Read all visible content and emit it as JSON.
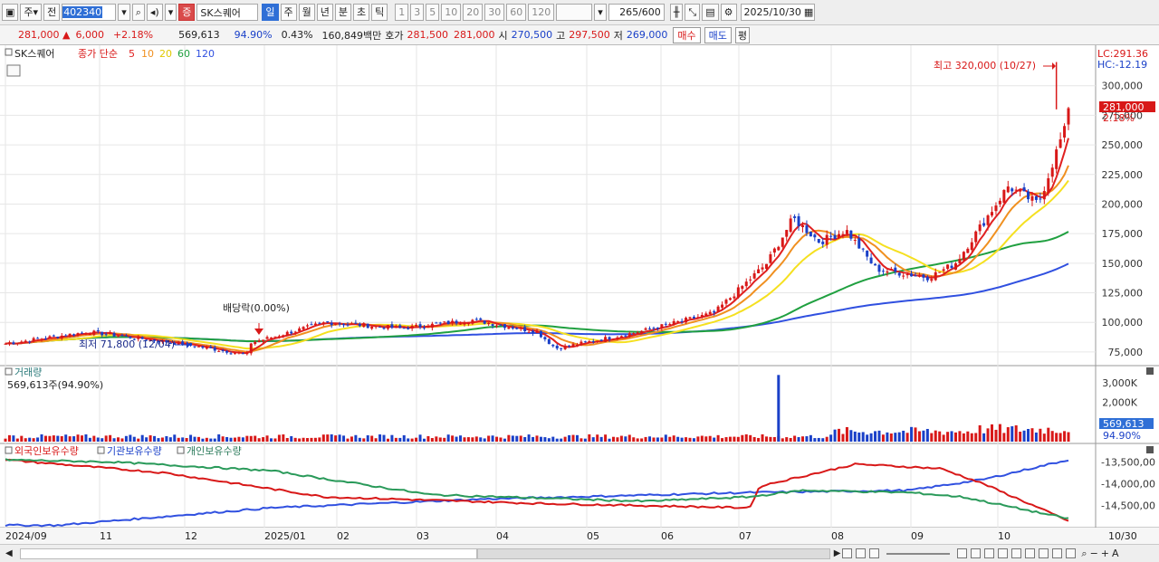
{
  "toolbar": {
    "type_label": "주",
    "prev_label": "전",
    "stock_code": "402340",
    "stock_name": "SK스퀘어",
    "badge_label": "증",
    "periods": [
      "일",
      "주",
      "월",
      "년",
      "분",
      "초",
      "틱"
    ],
    "selected_period": "일",
    "intervals": [
      "1",
      "3",
      "5",
      "10",
      "20",
      "30",
      "60",
      "120"
    ],
    "data_count": "265",
    "data_total": "/600",
    "date": "2025/10/30"
  },
  "quote": {
    "price": "281,000",
    "arrow": "▲",
    "change": "6,000",
    "change_pct": "+2.18%",
    "volume": "569,613",
    "vol_ratio": "94.90%",
    "turnover_pct": "0.43%",
    "amount": "160,849백만",
    "ask_label": "호가",
    "ask1": "281,500",
    "ask2": "281,000",
    "open_label": "시",
    "open": "270,500",
    "high_label": "고",
    "high": "297,500",
    "low_label": "저",
    "low": "269,000",
    "buy_label": "매수",
    "sell_label": "매도",
    "eval_label": "평"
  },
  "price_panel": {
    "stock_label": "SK스퀘어",
    "ma_label": "종가 단순",
    "ma_periods": [
      "5",
      "10",
      "20",
      "60",
      "120"
    ],
    "lc_label": "LC:291.36",
    "hc_label": "HC:-12.19",
    "high_annotation": "최고 320,000 (10/27)",
    "low_annotation": "최저 71,800 (12/04)",
    "dividend_annotation": "배당락(0.00%)",
    "current_price_tag": "281,000",
    "current_pct_tag": "2.18%",
    "y_ticks": [
      "300,000",
      "275,000",
      "250,000",
      "225,000",
      "200,000",
      "175,000",
      "150,000",
      "125,000",
      "100,000",
      "75,000"
    ]
  },
  "volume_panel": {
    "title": "거래량",
    "value_label": "569,613주(94.90%)",
    "y_ticks": [
      "3,000K",
      "2,000K",
      "1,000K"
    ],
    "current_tag": "569,613",
    "current_pct": "94.90%"
  },
  "holdings_panel": {
    "series_labels": [
      "외국인보유수량",
      "기관보유수량",
      "개인보유수량"
    ],
    "y_ticks": [
      "-13,500,00",
      "-14,000,00",
      "-14,500,00"
    ]
  },
  "x_axis": {
    "labels": [
      "2024/09",
      "11",
      "12",
      "2025/01",
      "02",
      "03",
      "04",
      "05",
      "06",
      "07",
      "08",
      "09",
      "10"
    ],
    "end_label": "10/30"
  },
  "colors": {
    "up": "#d81818",
    "down": "#1a40c8",
    "ma5": "#e02020",
    "ma10": "#f09020",
    "ma20": "#f5e020",
    "ma60": "#20a040",
    "ma120": "#3050e0",
    "foreign": "#3050e0",
    "institution": "#d81818",
    "individual": "#2a9a5a"
  },
  "chart_data": {
    "type": "candlestick",
    "ylim": [
      65000,
      325000
    ],
    "months": [
      "2024/09",
      "11",
      "12",
      "2025/01",
      "02",
      "03",
      "04",
      "05",
      "06",
      "07",
      "08",
      "09",
      "10"
    ],
    "close_key_points": [
      {
        "date": "2024-09",
        "value": 82000
      },
      {
        "date": "2024-10",
        "value": 92000
      },
      {
        "date": "2024-11",
        "value": 83000
      },
      {
        "date": "2024-12-04",
        "value": 72500
      },
      {
        "date": "2024-12",
        "value": 80000
      },
      {
        "date": "2025-01",
        "value": 100000
      },
      {
        "date": "2025-02",
        "value": 95000
      },
      {
        "date": "2025-03",
        "value": 102000
      },
      {
        "date": "2025-03-25",
        "value": 92000
      },
      {
        "date": "2025-04",
        "value": 78000
      },
      {
        "date": "2025-05",
        "value": 92000
      },
      {
        "date": "2025-06",
        "value": 108000
      },
      {
        "date": "2025-06-20",
        "value": 150000
      },
      {
        "date": "2025-07",
        "value": 188000
      },
      {
        "date": "2025-07-10",
        "value": 168000
      },
      {
        "date": "2025-07-20",
        "value": 178000
      },
      {
        "date": "2025-08",
        "value": 145000
      },
      {
        "date": "2025-08-20",
        "value": 138000
      },
      {
        "date": "2025-09",
        "value": 150000
      },
      {
        "date": "2025-09-20",
        "value": 215000
      },
      {
        "date": "2025-10-01",
        "value": 200000
      },
      {
        "date": "2025-10-10",
        "value": 255000
      },
      {
        "date": "2025-10-20",
        "value": 268000
      },
      {
        "date": "2025-10-27",
        "value": 292000
      },
      {
        "date": "2025-10-30",
        "value": 281000
      }
    ],
    "high": {
      "date": "2025-10-27",
      "value": 320000
    },
    "low": {
      "date": "2024-12-04",
      "value": 71800
    },
    "ma60_end": 190000,
    "ma120_end": 165000,
    "volume_spike": {
      "date": "2025-07-21",
      "value": 3400000
    },
    "volume_last": 569613
  }
}
